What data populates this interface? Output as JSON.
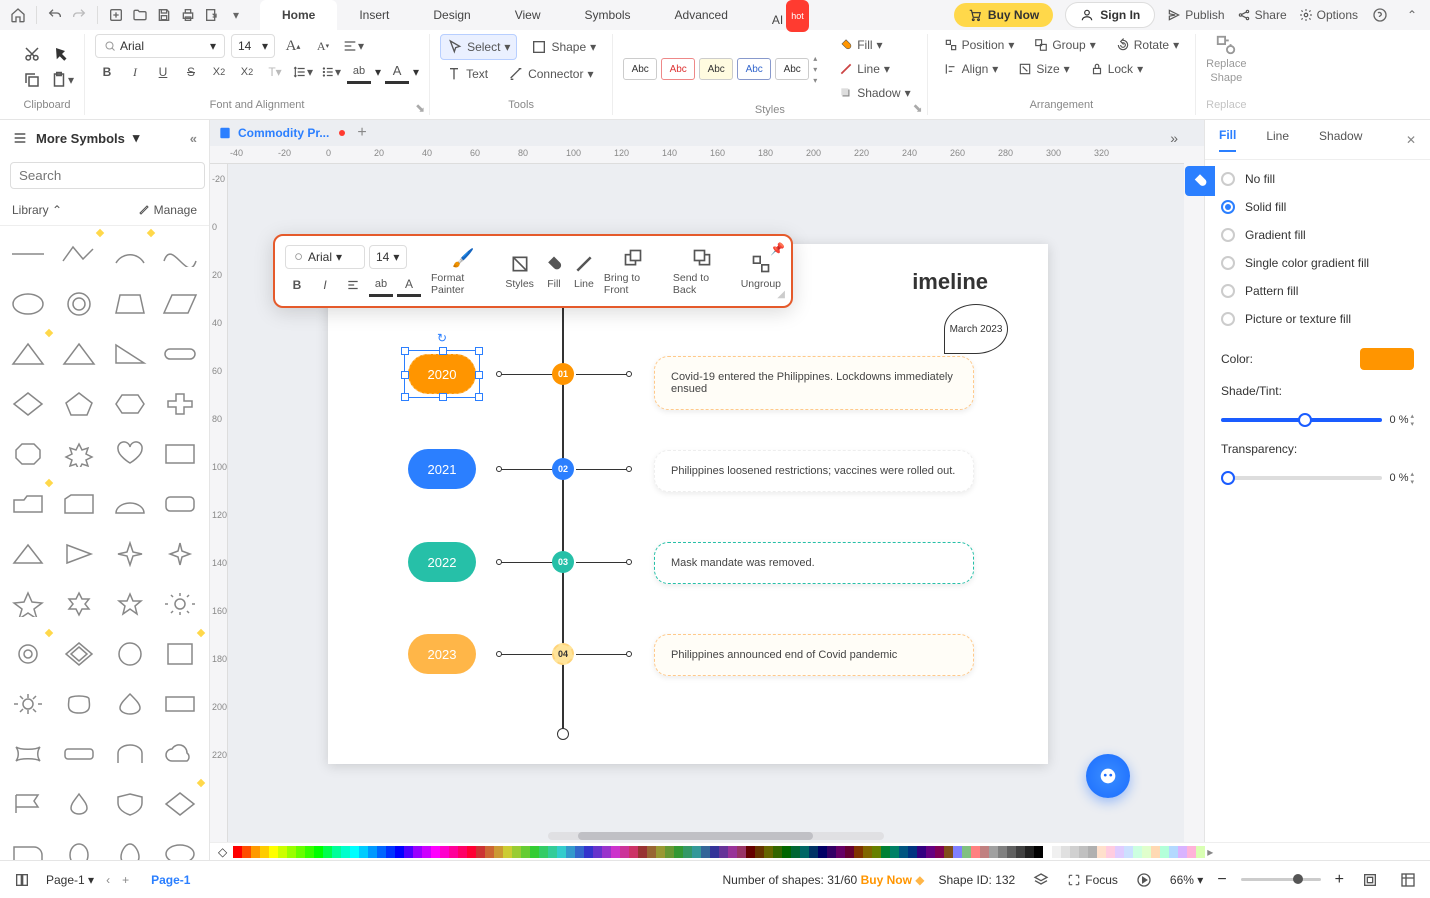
{
  "menubar": {
    "tabs": [
      "Home",
      "Insert",
      "Design",
      "View",
      "Symbols",
      "Advanced",
      "AI"
    ],
    "active": 0,
    "hot": "hot",
    "buy": "Buy Now",
    "signin": "Sign In",
    "right": [
      "Publish",
      "Share",
      "Options"
    ]
  },
  "ribbon": {
    "font": "Arial",
    "size": "14",
    "select": "Select",
    "shape": "Shape",
    "text": "Text",
    "connector": "Connector",
    "fill": "Fill",
    "line": "Line",
    "shadow": "Shadow",
    "position": "Position",
    "group": "Group",
    "rotate": "Rotate",
    "align": "Align",
    "sizeL": "Size",
    "lock": "Lock",
    "replace1": "Replace",
    "replace2": "Shape",
    "replace3": "Replace",
    "groups": {
      "clipboard": "Clipboard",
      "font": "Font and Alignment",
      "tools": "Tools",
      "styles": "Styles",
      "arrange": "Arrangement"
    },
    "abc": "Abc"
  },
  "left": {
    "more": "More Symbols",
    "searchPH": "Search",
    "searchBtn": "Search",
    "library": "Library",
    "manage": "Manage"
  },
  "doc": {
    "name": "Commodity Pr..."
  },
  "hruler": [
    "-40",
    "-20",
    "0",
    "20",
    "40",
    "60",
    "80",
    "100",
    "120",
    "140",
    "160",
    "180",
    "200",
    "220",
    "240",
    "260",
    "280",
    "300",
    "320"
  ],
  "vruler": [
    "-20",
    "0",
    "20",
    "40",
    "60",
    "80",
    "100",
    "120",
    "140",
    "160",
    "180",
    "200",
    "220"
  ],
  "timeline": {
    "title": "imeline",
    "date": "March 2023",
    "rows": [
      {
        "year": "2020",
        "n": "01",
        "txt": "Covid-19 entered the Philippines. Lockdowns immediately ensued",
        "yc": "#ff9500",
        "nc": "#ff9500",
        "bc": "#ffc98a"
      },
      {
        "year": "2021",
        "n": "02",
        "txt": "Philippines loosened restrictions; vaccines were rolled out.",
        "yc": "#2b7fff",
        "nc": "#2b7fff",
        "bc": "#e5e5e5"
      },
      {
        "year": "2022",
        "n": "03",
        "txt": "Mask mandate was removed.",
        "yc": "#26c0a8",
        "nc": "#26c0a8",
        "bc": "#26c0a8"
      },
      {
        "year": "2023",
        "n": "04",
        "txt": "Philippines announced end of Covid pandemic",
        "yc": "#ffb648",
        "nc": "#ffd47a",
        "bc": "#ffc98a"
      }
    ]
  },
  "float": {
    "font": "Arial",
    "size": "14",
    "items": [
      "Format Painter",
      "Styles",
      "Fill",
      "Line",
      "Bring to Front",
      "Send to Back",
      "Ungroup"
    ]
  },
  "right": {
    "tabs": [
      "Fill",
      "Line",
      "Shadow"
    ],
    "opts": [
      "No fill",
      "Solid fill",
      "Gradient fill",
      "Single color gradient fill",
      "Pattern fill",
      "Picture or texture fill"
    ],
    "selOpt": 1,
    "color": "Color:",
    "shade": "Shade/Tint:",
    "trans": "Transparency:",
    "shadeVal": "0 %",
    "transVal": "0 %"
  },
  "status": {
    "page": "Page-1",
    "page2": "Page-1",
    "shapes": "Number of shapes: 31/60",
    "buy": "Buy Now",
    "shapeId": "Shape ID: 132",
    "focus": "Focus",
    "zoom": "66%"
  },
  "palette": [
    "#ff0000",
    "#ff4d00",
    "#ff9900",
    "#ffcc00",
    "#ffff00",
    "#ccff00",
    "#99ff00",
    "#66ff00",
    "#33ff00",
    "#00ff00",
    "#00ff4d",
    "#00ff99",
    "#00ffcc",
    "#00ffff",
    "#00ccff",
    "#0099ff",
    "#0066ff",
    "#0033ff",
    "#0000ff",
    "#4d00ff",
    "#9900ff",
    "#cc00ff",
    "#ff00ff",
    "#ff00cc",
    "#ff0099",
    "#ff0066",
    "#ff0033",
    "#cc3333",
    "#cc6633",
    "#cc9933",
    "#cccc33",
    "#99cc33",
    "#66cc33",
    "#33cc33",
    "#33cc66",
    "#33cc99",
    "#33cccc",
    "#3399cc",
    "#3366cc",
    "#3333cc",
    "#6633cc",
    "#9933cc",
    "#cc33cc",
    "#cc3399",
    "#cc3366",
    "#993333",
    "#996633",
    "#999933",
    "#669933",
    "#339933",
    "#339966",
    "#339999",
    "#336699",
    "#333399",
    "#663399",
    "#993399",
    "#993366",
    "#660000",
    "#663300",
    "#666600",
    "#336600",
    "#006600",
    "#006633",
    "#006666",
    "#003366",
    "#000066",
    "#330066",
    "#660066",
    "#660033",
    "#803300",
    "#806600",
    "#668000",
    "#008033",
    "#008066",
    "#005580",
    "#003380",
    "#330080",
    "#660080",
    "#800055",
    "#804d1a",
    "#8080ff",
    "#80c080",
    "#ff8080",
    "#c08080",
    "#a0a0a0",
    "#808080",
    "#606060",
    "#404040",
    "#202020",
    "#000000",
    "#ffffff",
    "#f0f0f0",
    "#e0e0e0",
    "#d0d0d0",
    "#c0c0c0",
    "#b0b0b0",
    "#ffe0cc",
    "#ffcce0",
    "#e0ccff",
    "#cce0ff",
    "#ccffe0",
    "#e0ffcc",
    "#ffd9b3",
    "#b3ffd9",
    "#b3d9ff",
    "#d9b3ff",
    "#ffb3d9",
    "#d9ffb3"
  ]
}
